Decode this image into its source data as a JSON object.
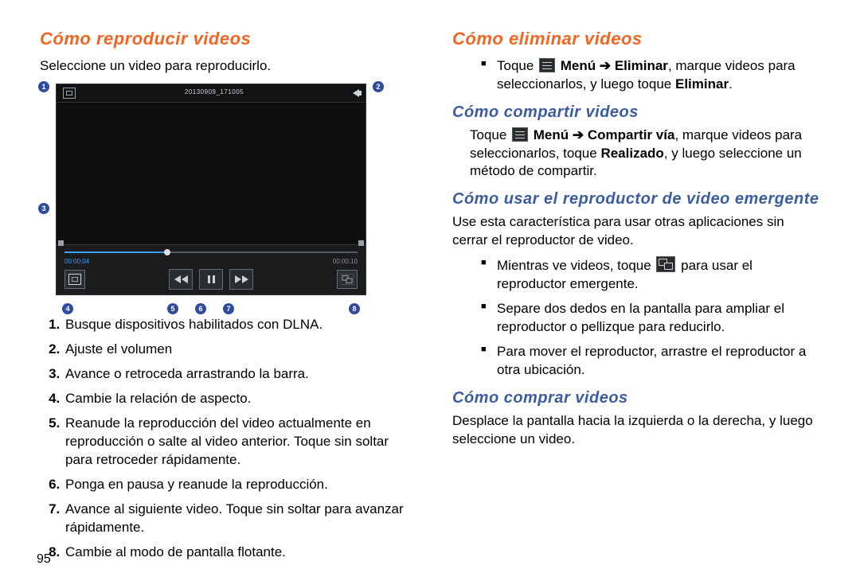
{
  "left": {
    "heading": "Cómo reproducir videos",
    "intro": "Seleccione un video para reproducirlo.",
    "player": {
      "timestampTitle": "20130909_171005",
      "timeCurrent": "00:00:04",
      "timeTotal": "00:00:10"
    },
    "callouts": {
      "c1": "1",
      "c2": "2",
      "c3": "3",
      "c4": "4",
      "c5": "5",
      "c6": "6",
      "c7": "7",
      "c8": "8"
    },
    "steps": [
      "Busque dispositivos habilitados con DLNA.",
      "Ajuste el volumen",
      "Avance o retroceda arrastrando la barra.",
      "Cambie la relación de aspecto.",
      "Reanude la reproducción del video actualmente en reproducción o salte al video anterior. Toque sin soltar para retroceder rápidamente.",
      "Ponga en pausa y reanude la reproducción.",
      "Avance al siguiente video. Toque sin soltar para avanzar rápidamente.",
      "Cambie al modo de pantalla flotante."
    ]
  },
  "right": {
    "h1": "Cómo eliminar videos",
    "delete_a": "Toque ",
    "delete_b": " Menú ➔ Eliminar",
    "delete_c": ", marque videos para seleccionarlos, y luego toque ",
    "delete_d": "Eliminar",
    "delete_e": ".",
    "h2": "Cómo compartir videos",
    "share_a": "Toque ",
    "share_b": " Menú ➔ Compartir vía",
    "share_c": ", marque videos para seleccionarlos, toque ",
    "share_d": "Realizado",
    "share_e": ", y luego seleccione un método de compartir.",
    "h3": "Cómo usar el reproductor de video emergente",
    "pv_intro": "Use esta característica para usar otras aplicaciones sin cerrar el reproductor de video.",
    "pv_b1a": "Mientras ve videos, toque ",
    "pv_b1b": " para usar el reproductor emergente.",
    "pv_b2": "Separe dos dedos en la pantalla para ampliar el reproductor o pellizque para reducirlo.",
    "pv_b3": "Para mover el reproductor, arrastre el reproductor a otra ubicación.",
    "h4": "Cómo comprar videos",
    "buy": "Desplace la pantalla hacia la izquierda o la derecha, y luego seleccione un video."
  },
  "pageNumber": "95"
}
